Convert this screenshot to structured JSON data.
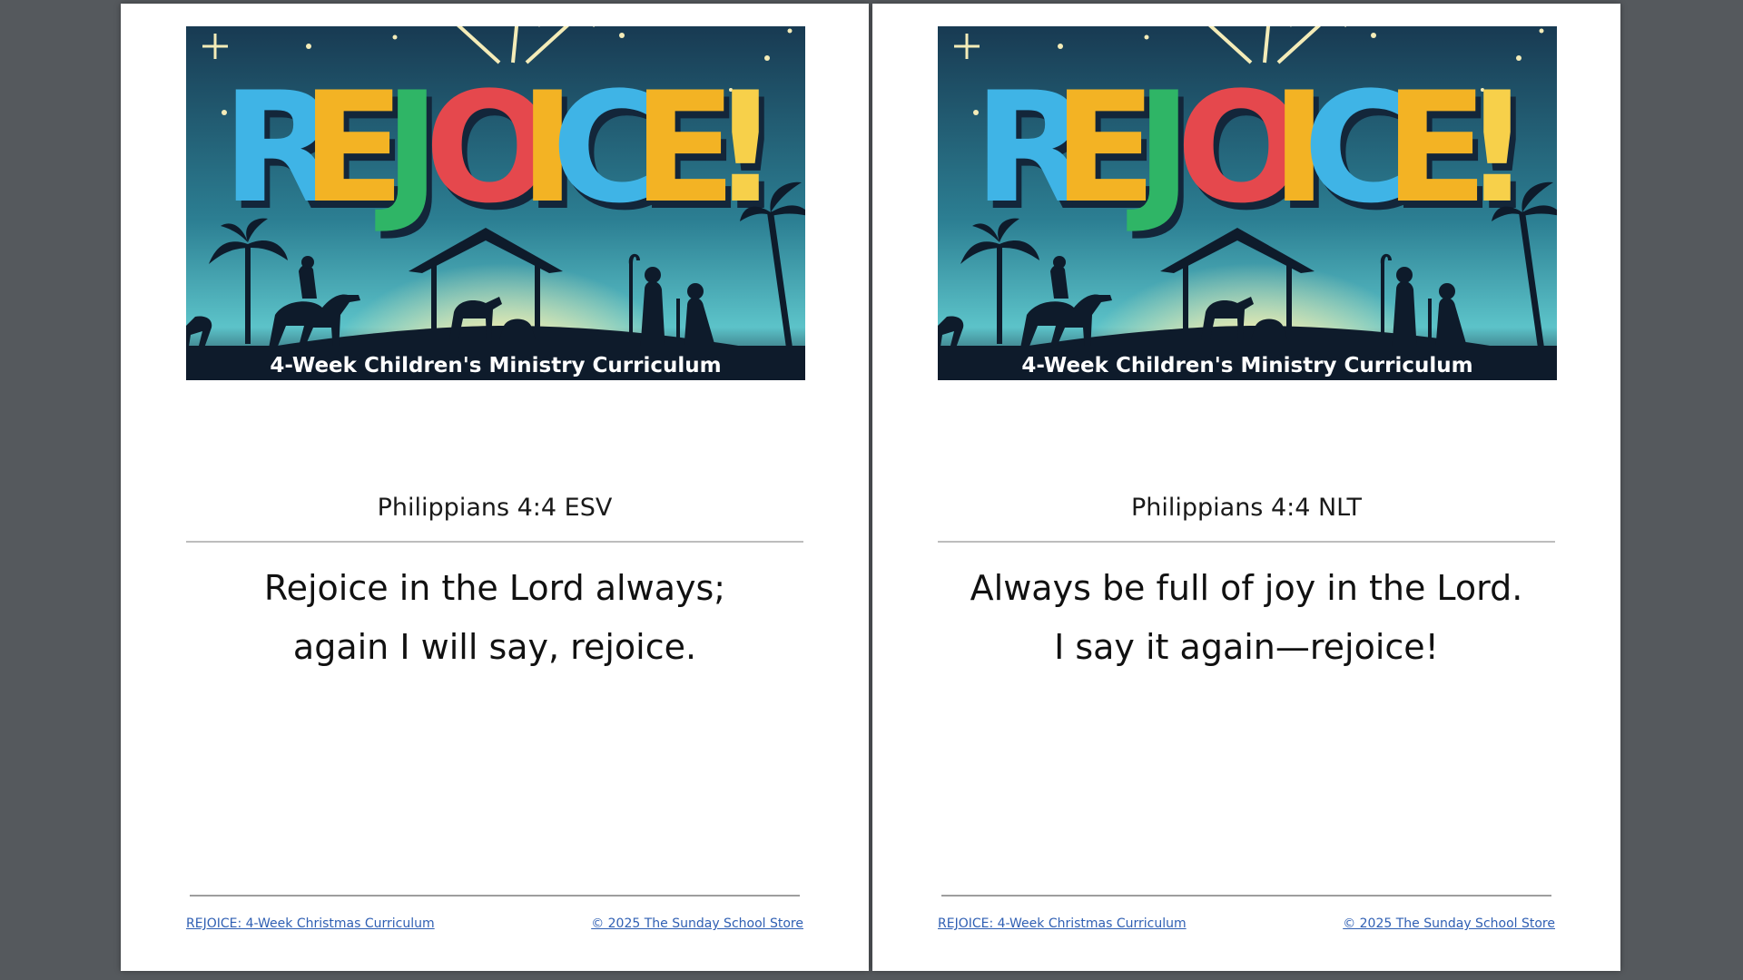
{
  "pages": [
    {
      "banner": {
        "title": "REJOICE!",
        "subtitle": "4-Week Children's Ministry Curriculum"
      },
      "reference": "Philippians 4:4 ESV",
      "verse_lines": [
        "Rejoice in the Lord always;",
        "again I will say, rejoice."
      ],
      "footer": {
        "left": "REJOICE: 4-Week Christmas Curriculum",
        "right": "© 2025 The Sunday School Store"
      }
    },
    {
      "banner": {
        "title": "REJOICE!",
        "subtitle": "4-Week Children's Ministry Curriculum"
      },
      "reference": "Philippians 4:4 NLT",
      "verse_lines": [
        "Always be full of joy in the Lord.",
        "I say it again—rejoice!"
      ],
      "footer": {
        "left": "REJOICE: 4-Week Christmas Curriculum",
        "right": "© 2025 The Sunday School Store"
      }
    }
  ],
  "colors": {
    "background": "#55595d",
    "link": "#2f5fb3",
    "sky": "#1c3f55",
    "letters": [
      "#3fb4e6",
      "#f3b324",
      "#2fb566",
      "#e5484d",
      "#3fb4e6",
      "#f3b324",
      "#f3b324"
    ]
  },
  "icons": [
    "star-icon",
    "palm-tree-icon",
    "camel-rider-icon",
    "stable-icon",
    "shepherd-icon"
  ]
}
